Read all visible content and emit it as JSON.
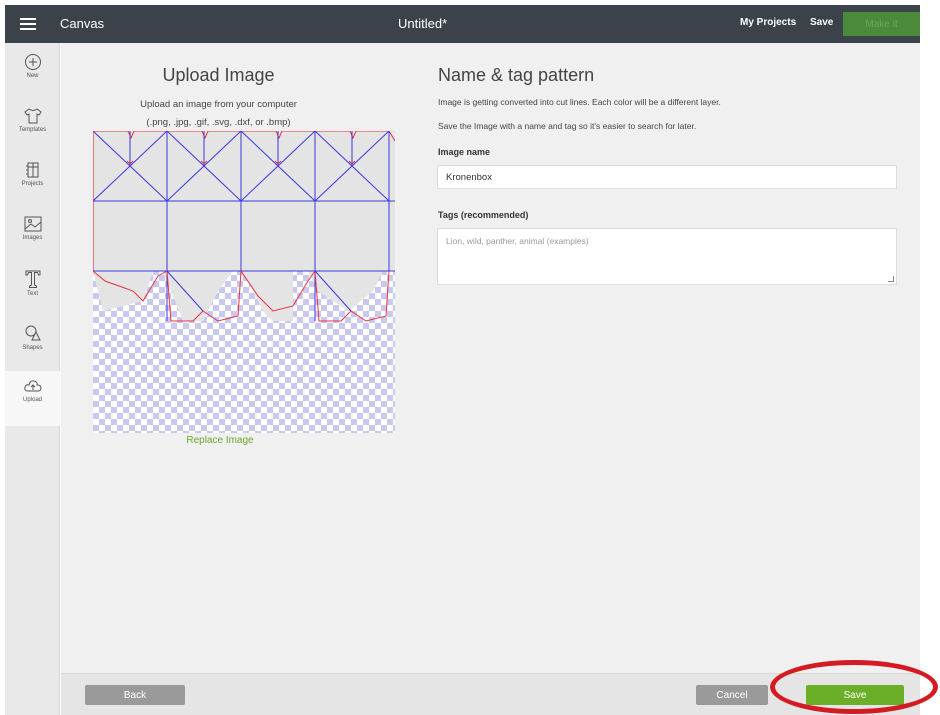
{
  "topbar": {
    "app_name": "Canvas",
    "doc_title": "Untitled*",
    "my_projects": "My Projects",
    "save": "Save",
    "make": "Make it"
  },
  "sidebar": {
    "items": [
      {
        "label": "New",
        "icon": "plus-circle-icon"
      },
      {
        "label": "Templates",
        "icon": "tshirt-icon"
      },
      {
        "label": "Projects",
        "icon": "projects-icon"
      },
      {
        "label": "Images",
        "icon": "image-icon"
      },
      {
        "label": "Text",
        "icon": "text-icon"
      },
      {
        "label": "Shapes",
        "icon": "shapes-icon"
      },
      {
        "label": "Upload",
        "icon": "cloud-upload-icon"
      }
    ],
    "active": "Upload"
  },
  "upload": {
    "title": "Upload Image",
    "subtitle1": "Upload an image from your computer",
    "subtitle2": "(.png, .jpg, .gif, .svg, .dxf, or .bmp)",
    "replace": "Replace Image"
  },
  "form": {
    "title": "Name & tag pattern",
    "info1": "Image is getting converted into cut lines. Each color will be a different layer.",
    "info2": "Save the Image with a name and tag so it's easier to search for later.",
    "name_label": "Image name",
    "name_value": "Kronenbox",
    "tags_label": "Tags (recommended)",
    "tags_placeholder": "Lion, wild, panther, animal (examples)"
  },
  "footer": {
    "back": "Back",
    "cancel": "Cancel",
    "save": "Save"
  },
  "colors": {
    "topbar": "#3b4249",
    "accent_green": "#6aaf27",
    "highlight_red": "#d41a22",
    "cut_line_red": "#e8333c",
    "score_line_blue": "#3a3ae0"
  }
}
